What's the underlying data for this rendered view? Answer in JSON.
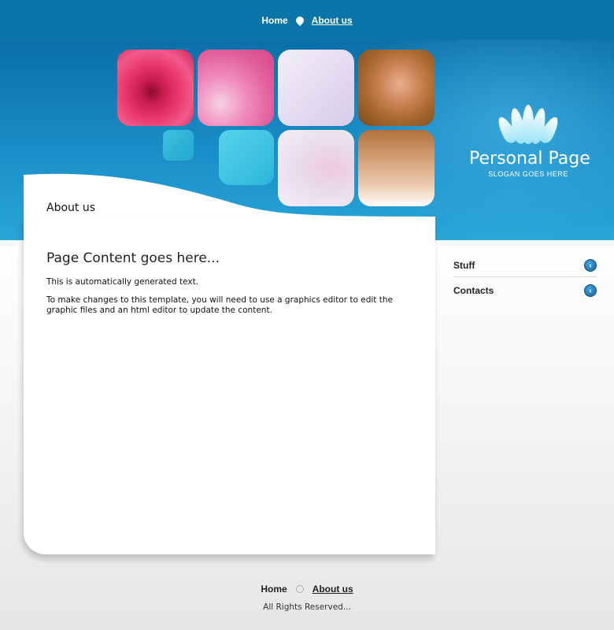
{
  "nav": {
    "home_label": "Home",
    "about_label": "About us"
  },
  "header": {
    "site_title": "Personal Page",
    "slogan": "SLOGAN GOES HERE"
  },
  "content": {
    "section_title": "About us",
    "heading": "Page Content goes here...",
    "paragraph1": "This is automatically generated text.",
    "paragraph2": "To make changes to this template, you will need to use a graphics editor to edit the graphic files and an html editor to update the content."
  },
  "sidebar": {
    "items": [
      {
        "label": "Stuff",
        "icon": "chevron-left-circle-icon"
      },
      {
        "label": "Contacts",
        "icon": "chevron-left-circle-icon"
      }
    ]
  },
  "footer": {
    "home_label": "Home",
    "about_label": "About us",
    "copyright": "All Rights Reserved..."
  },
  "colors": {
    "header_blue": "#0b74a9",
    "accent_cyan": "#2bb6dc",
    "text_dark": "#111111"
  }
}
